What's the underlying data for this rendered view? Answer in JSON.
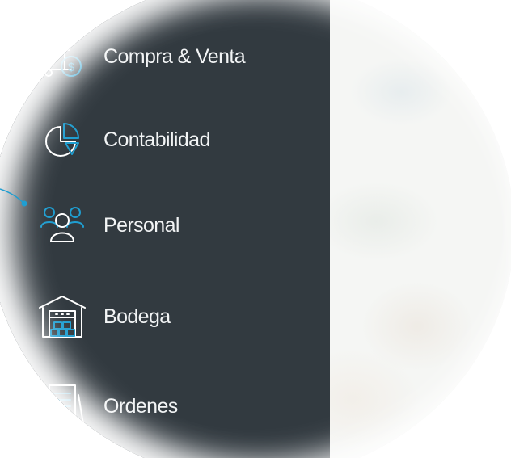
{
  "menu": {
    "items": [
      {
        "label": "Compra & Venta",
        "icon": "truck-dollar-icon"
      },
      {
        "label": "Contabilidad",
        "icon": "pie-chart-icon"
      },
      {
        "label": "Personal",
        "icon": "people-group-icon"
      },
      {
        "label": "Bodega",
        "icon": "warehouse-icon"
      },
      {
        "label": "Ordenes",
        "icon": "documents-icon"
      }
    ]
  },
  "colors": {
    "sidebar_bg": "#323a40",
    "icon_stroke": "#ffffff",
    "accent": "#1f9ed1",
    "label_text": "#f2f4f5",
    "content_bg": "#f5f6f4"
  }
}
